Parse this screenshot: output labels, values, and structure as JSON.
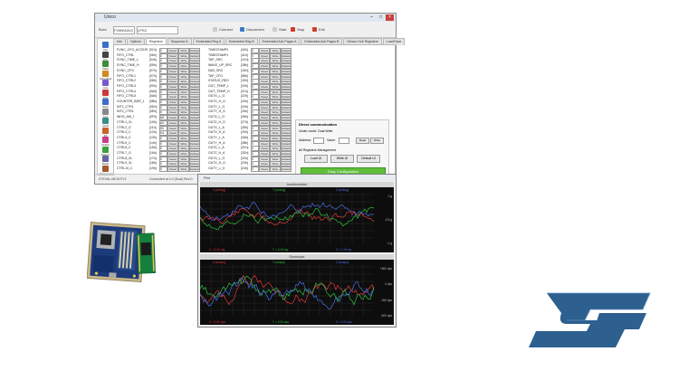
{
  "window": {
    "title": "Unico",
    "controls": [
      "–",
      "□",
      "×"
    ]
  },
  "toolbar": {
    "board_label": "Bord",
    "board_value": "FVMEA3V2",
    "device_value": "LPS3",
    "buttons": [
      {
        "label": "Connect",
        "icon": "plug-icon",
        "color": "#cccccc"
      },
      {
        "label": "Disconnect",
        "icon": "unplug-icon",
        "color": "#3c78c8"
      },
      {
        "label": "Start",
        "icon": "play-icon",
        "color": "#cccccc"
      },
      {
        "label": "Stop",
        "icon": "stop-icon",
        "color": "#d23b2b"
      },
      {
        "label": "Exit",
        "icon": "exit-icon",
        "color": "#d23b2b"
      }
    ]
  },
  "tabs": [
    {
      "label": "Info",
      "active": false
    },
    {
      "label": "Options",
      "active": false
    },
    {
      "label": "Registers",
      "active": true
    },
    {
      "label": "Sequence A",
      "active": false
    },
    {
      "label": "Embedded Reg A",
      "active": false
    },
    {
      "label": "Embedded Reg B",
      "active": false
    },
    {
      "label": "Embedded Adv Pages A",
      "active": false
    },
    {
      "label": "Embedded Adv Pages B",
      "active": false
    },
    {
      "label": "Sensor Hub Registers",
      "active": false
    },
    {
      "label": "Load/Save",
      "active": false
    }
  ],
  "sidebar": [
    {
      "label": "Info",
      "icon": "info-icon",
      "color": "#3c6ec8"
    },
    {
      "label": "Pin",
      "icon": "pin-icon",
      "color": "#444444"
    },
    {
      "label": "Data",
      "icon": "data-icon",
      "color": "#3c8c3c"
    },
    {
      "label": "Scheduler",
      "icon": "scheduler-icon",
      "color": "#d08a20"
    },
    {
      "label": "Aux",
      "icon": "aux-icon",
      "color": "#7a5ac8"
    },
    {
      "label": "Plot",
      "icon": "plot-icon",
      "color": "#c83c3c"
    },
    {
      "label": "Save",
      "icon": "save-icon",
      "color": "#3c6ec8"
    },
    {
      "label": "Log",
      "icon": "log-icon",
      "color": "#888888"
    },
    {
      "label": "Quat",
      "icon": "quat-icon",
      "color": "#3c8c8c"
    },
    {
      "label": "Fft",
      "icon": "fft-icon",
      "color": "#c8642c"
    },
    {
      "label": "Graph",
      "icon": "graph-icon",
      "color": "#c83c8c"
    },
    {
      "label": "Pedom",
      "icon": "pedometer-icon",
      "color": "#3ca03c"
    },
    {
      "label": "Mask",
      "icon": "mask-icon",
      "color": "#6464a0"
    },
    {
      "label": "Pedometer",
      "icon": "pedometer2-icon",
      "color": "#a05a2c"
    }
  ],
  "registers": {
    "buttons": [
      "Read",
      "Write",
      "Default"
    ],
    "left": [
      {
        "name": "FUNC_CFG_ACCESS",
        "addr": "[01h]",
        "value": "0"
      },
      {
        "name": "FIFO_CTRL",
        "addr": "[06h]",
        "value": "0"
      },
      {
        "name": "SYNC_TIME_L",
        "addr": "[04h]",
        "value": "0"
      },
      {
        "name": "SYNC_TIME_H",
        "addr": "[05h]",
        "value": "0"
      },
      {
        "name": "SYNC_CFG",
        "addr": "[07h]",
        "value": "0"
      },
      {
        "name": "FIFO_CTRL1",
        "addr": "[07h]",
        "value": "0"
      },
      {
        "name": "FIFO_CTRL2",
        "addr": "[08h]",
        "value": "0"
      },
      {
        "name": "FIFO_CTRL3",
        "addr": "[09h]",
        "value": "0"
      },
      {
        "name": "FIFO_CTRL4",
        "addr": "[0Ah]",
        "value": "0"
      },
      {
        "name": "FIFO_CTRL5",
        "addr": "[0Ah]",
        "value": "0"
      },
      {
        "name": "COUNTER_BDR_1",
        "addr": "[0Bh]",
        "value": "0"
      },
      {
        "name": "INT1_CTRL",
        "addr": "[0Dh]",
        "value": "0"
      },
      {
        "name": "INT2_CTRL",
        "addr": "[0Eh]",
        "value": "0"
      },
      {
        "name": "WHO_AM_I",
        "addr": "[0Fh]",
        "value": "6A"
      },
      {
        "name": "CTRL1_XL",
        "addr": "[10h]",
        "value": "A0"
      },
      {
        "name": "CTRL2_G",
        "addr": "[11h]",
        "value": "00"
      },
      {
        "name": "CTRL3_C",
        "addr": "[12h]",
        "value": "04"
      },
      {
        "name": "CTRL4_C",
        "addr": "[13h]",
        "value": "0"
      },
      {
        "name": "CTRL5_C",
        "addr": "[14h]",
        "value": "0"
      },
      {
        "name": "CTRL6_C",
        "addr": "[15h]",
        "value": "0"
      },
      {
        "name": "CTRL7_G",
        "addr": "[16h]",
        "value": "0"
      },
      {
        "name": "CTRL8_XL",
        "addr": "[17h]",
        "value": "0"
      },
      {
        "name": "CTRL9_XL",
        "addr": "[18h]",
        "value": "0"
      },
      {
        "name": "CTRL10_C",
        "addr": "[19h]",
        "value": "0"
      }
    ],
    "right": [
      {
        "name": "TIMESTAMP0",
        "addr": "[40h]",
        "value": "0"
      },
      {
        "name": "TIMESTAMP1",
        "addr": "[41h]",
        "value": "0"
      },
      {
        "name": "TAP_SRC",
        "addr": "[1Ch]",
        "value": "0"
      },
      {
        "name": "WAKE_UP_SRC",
        "addr": "[1Bh]",
        "value": "0"
      },
      {
        "name": "D6D_SRC",
        "addr": "[1Dh]",
        "value": "0"
      },
      {
        "name": "TAP_CFG",
        "addr": "[58h]",
        "value": "0"
      },
      {
        "name": "STATUS_REG",
        "addr": "[1Eh]",
        "value": "0"
      },
      {
        "name": "OUT_TEMP_L",
        "addr": "[20h]",
        "value": "0"
      },
      {
        "name": "OUT_TEMP_H",
        "addr": "[21h]",
        "value": "0"
      },
      {
        "name": "OUTX_L_G",
        "addr": "[22h]",
        "value": "0"
      },
      {
        "name": "OUTX_H_G",
        "addr": "[23h]",
        "value": "0"
      },
      {
        "name": "OUTY_L_G",
        "addr": "[24h]",
        "value": "0"
      },
      {
        "name": "OUTY_H_G",
        "addr": "[25h]",
        "value": "0"
      },
      {
        "name": "OUTZ_L_G",
        "addr": "[26h]",
        "value": "0"
      },
      {
        "name": "OUTZ_H_G",
        "addr": "[27h]",
        "value": "0"
      },
      {
        "name": "OUTX_L_A",
        "addr": "[28h]",
        "value": "0"
      },
      {
        "name": "OUTX_H_A",
        "addr": "[29h]",
        "value": "0"
      },
      {
        "name": "OUTY_L_A",
        "addr": "[2Ah]",
        "value": "0"
      },
      {
        "name": "OUTY_H_A",
        "addr": "[2Bh]",
        "value": "0"
      },
      {
        "name": "OUTZ_L_A",
        "addr": "[2Ch]",
        "value": "0"
      },
      {
        "name": "OUTZ_H_A",
        "addr": "[2Dh]",
        "value": "0"
      },
      {
        "name": "OUTX_L_G",
        "addr": "[22h]",
        "value": "0"
      },
      {
        "name": "OUTX_H_G",
        "addr": "[23h]",
        "value": "0"
      },
      {
        "name": "OUTY_L_G",
        "addr": "[24h]",
        "value": "0"
      }
    ]
  },
  "direct_comm": {
    "title": "Direct communication",
    "mode_label": "Under mode: Dual Write",
    "address_label": "Address:",
    "address_value": "",
    "value_label": "Value:",
    "value_value": "",
    "read_button": "Read",
    "write_button": "Write",
    "all_registers_label": "All Registers Management",
    "load_button": "Load UI",
    "write_all_button": "Write UI",
    "default_button": "Default UI",
    "config_button": "Easy Configuration"
  },
  "statusbar": {
    "left": "STEVAL-MKI197V1",
    "right": "Connected at 4.0 (Dual) Rev.D"
  },
  "plot": {
    "title": "Plot",
    "panes": [
      {
        "title": "Accelerometer",
        "legend": [
          "X [mdeg]",
          "Y [mdeg]",
          "Z [mdeg]"
        ],
        "yticks": [
          "0 g",
          "-0.5 g",
          "-1 g"
        ],
        "footer": [
          "X = 0.10 mg",
          "Y = 0.10 mg",
          "Z = 0.10 mg"
        ]
      },
      {
        "title": "Gyroscope",
        "legend": [
          "X [mdps]",
          "Y [mdps]",
          "Z [mdps]"
        ],
        "yticks": [
          "+500 dps",
          "0 dps",
          "-250 dps",
          "-500 dps"
        ],
        "footer": [
          "X = 0.00 dps",
          "Y = 0.00 dps",
          "Z = 0.00 dps"
        ]
      }
    ],
    "colors": {
      "x": "#e23a3a",
      "y": "#2fbf3f",
      "z": "#4a70e8"
    }
  },
  "logo": {
    "text": "ST",
    "color": "#2d5f8f"
  }
}
